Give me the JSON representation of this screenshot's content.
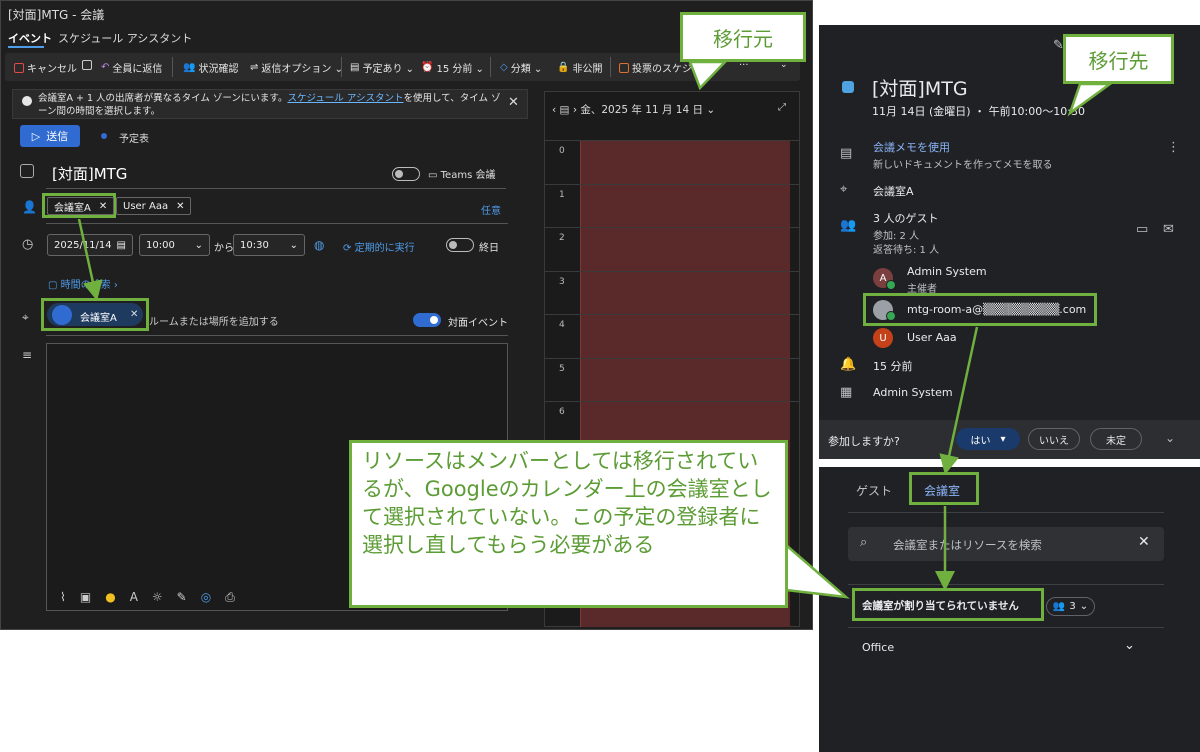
{
  "outlook": {
    "window_title": "[対面]MTG - 会議",
    "tabs": [
      "イベント",
      "スケジュール アシスタント"
    ],
    "toolbar": [
      "キャンセル",
      "全員に返信",
      "状況確認",
      "返信オプション ⌄",
      "予定あり ⌄",
      "15 分前 ⌄",
      "分類 ⌄",
      "非公開",
      "投票のスケジュ..."
    ],
    "toolbar_more": "···",
    "info_prefix": "会議室A + 1 人の出席者が異なるタイム ゾーンにいます。",
    "info_link": "スケジュール アシスタント",
    "info_suffix": "を使用して、タイム ゾーン間の時間を選択します。",
    "close": "✕",
    "send_label": "送信",
    "calendar_label": "予定表",
    "title_value": "[対面]MTG",
    "teams_label": "Teams 会議",
    "attendees": [
      "会議室A",
      "User Aaa"
    ],
    "optional_label": "任意",
    "start_date": "2025/11/14",
    "start_time": "10:00",
    "to_label": "から",
    "end_time": "10:30",
    "recurring_label": "定期的に実行",
    "allday_label": "終日",
    "time_search": "時間の検索",
    "room_chip": "会議室A",
    "room_placeholder": "ルームまたは場所を追加する",
    "inperson_label": "対面イベント",
    "calendar_header": "金、2025 年 11 月 14 日 ⌄",
    "hours": [
      "0",
      "1",
      "2",
      "3",
      "4",
      "5",
      "6"
    ]
  },
  "callouts": {
    "source": "移行元",
    "destination": "移行先",
    "note": "リソースはメンバーとしては移行されているが、Googleのカレンダー上の会議室として選択されていない。この予定の登録者に選択し直してもらう必要がある"
  },
  "google": {
    "event_title": "[対面]MTG",
    "event_time": "11月 14日 (金曜日) ・ 午前10:00～10:30",
    "notes_title": "会議メモを使用",
    "notes_sub": "新しいドキュメントを作ってメモを取る",
    "location": "会議室A",
    "guests_count": "3 人のゲスト",
    "guests_yes": "参加: 2 人",
    "guests_wait": "返答待ち: 1 人",
    "guests": [
      {
        "initial": "A",
        "name": "Admin System",
        "role": "主催者",
        "color": "#7b3f3f"
      },
      {
        "initial": "",
        "name": "mtg-room-a@▒▒▒▒▒▒▒▒▒.com",
        "role": "",
        "color": "#9aa0a6"
      },
      {
        "initial": "U",
        "name": "User Aaa",
        "role": "",
        "color": "#c5411a"
      }
    ],
    "reminder": "15 分前",
    "organizer": "Admin System",
    "rsvp_question": "参加しますか?",
    "rsvp_yes": "はい",
    "rsvp_no": "いいえ",
    "rsvp_maybe": "未定",
    "room_tabs": [
      "ゲスト",
      "会議室"
    ],
    "room_search_placeholder": "会議室またはリソースを検索",
    "no_room": "会議室が割り当てられていません",
    "room_count": "3",
    "office_label": "Office"
  },
  "colors": {
    "accent_green": "#6fb03f",
    "outlook_blue": "#2f6bd1",
    "google_blue": "#8ab4f8",
    "calendar_busy": "#5a2a2a"
  }
}
